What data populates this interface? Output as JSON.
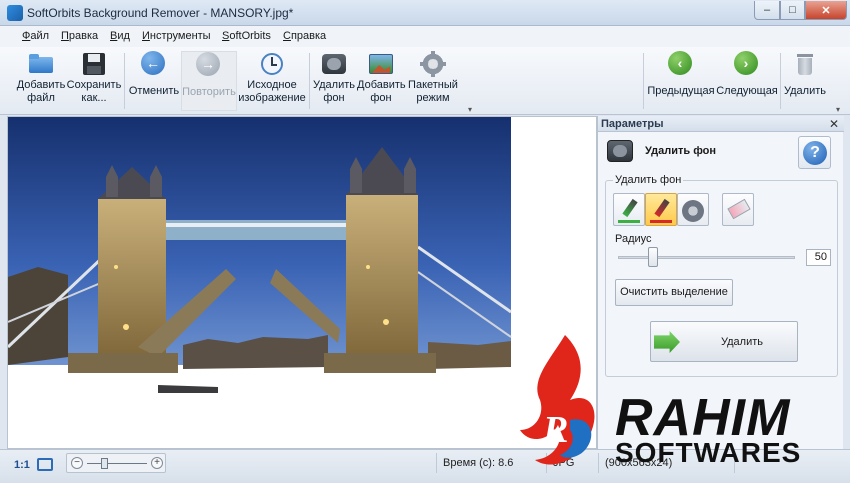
{
  "window": {
    "title": "SoftOrbits Background Remover - MANSORY.jpg*",
    "min": "–",
    "max": "□",
    "close": "✕"
  },
  "menu": [
    "Файл",
    "Правка",
    "Вид",
    "Инструменты",
    "SoftOrbits",
    "Справка"
  ],
  "toolbar": {
    "add_file": "Добавить\nфайл",
    "save_as": "Сохранить\nкак...",
    "undo": "Отменить",
    "redo": "Повторить",
    "original": "Исходное\nизображение",
    "remove_bg": "Удалить\nфон",
    "add_bg": "Добавить\nфон",
    "batch": "Пакетный\nрежим",
    "prev": "Предыдущая",
    "next": "Следующая",
    "delete": "Удалить"
  },
  "panel": {
    "title": "Параметры",
    "close": "✕",
    "subtitle": "Удалить фон",
    "help": "?",
    "group_label": "Удалить фон",
    "radius_label": "Радиус",
    "radius_value": "50",
    "radius_fraction": 0.2,
    "clear_button": "Очистить выделение",
    "remove_button": "Удалить"
  },
  "status": {
    "zoom_11": "1:1",
    "zoom_minus": "−",
    "zoom_plus": "+",
    "time": "Время (с): 8.6",
    "format": "JPG",
    "dimensions": "(900x563x24)"
  },
  "watermark": {
    "line1": "RAHIM",
    "line2": "SOFTWARES"
  },
  "colors": {
    "accent": "#2d6fc0",
    "sky": "#1f3f8a",
    "brush_selected": "#ffc94a",
    "watermark_red": "#e0251b"
  }
}
